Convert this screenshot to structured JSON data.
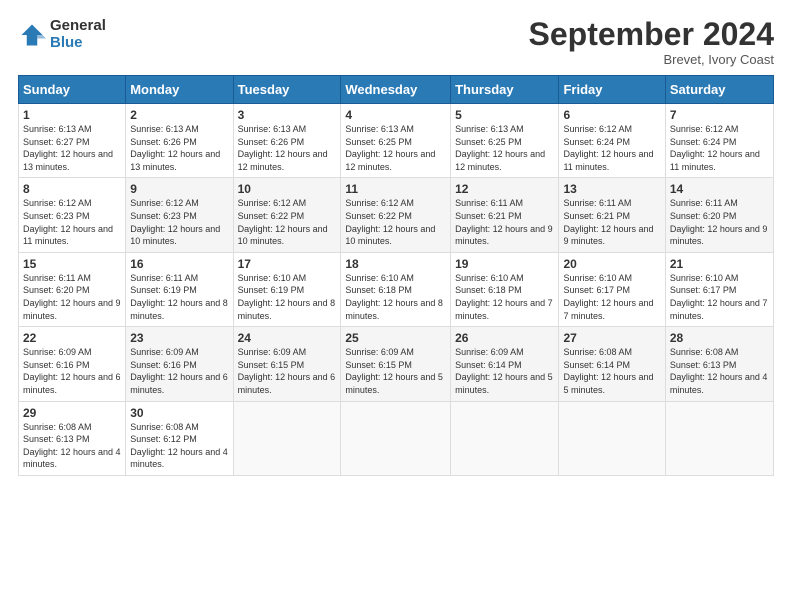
{
  "header": {
    "logo_general": "General",
    "logo_blue": "Blue",
    "month_title": "September 2024",
    "location": "Brevet, Ivory Coast"
  },
  "weekdays": [
    "Sunday",
    "Monday",
    "Tuesday",
    "Wednesday",
    "Thursday",
    "Friday",
    "Saturday"
  ],
  "weeks": [
    [
      {
        "day": "1",
        "sunrise": "Sunrise: 6:13 AM",
        "sunset": "Sunset: 6:27 PM",
        "daylight": "Daylight: 12 hours and 13 minutes."
      },
      {
        "day": "2",
        "sunrise": "Sunrise: 6:13 AM",
        "sunset": "Sunset: 6:26 PM",
        "daylight": "Daylight: 12 hours and 13 minutes."
      },
      {
        "day": "3",
        "sunrise": "Sunrise: 6:13 AM",
        "sunset": "Sunset: 6:26 PM",
        "daylight": "Daylight: 12 hours and 12 minutes."
      },
      {
        "day": "4",
        "sunrise": "Sunrise: 6:13 AM",
        "sunset": "Sunset: 6:25 PM",
        "daylight": "Daylight: 12 hours and 12 minutes."
      },
      {
        "day": "5",
        "sunrise": "Sunrise: 6:13 AM",
        "sunset": "Sunset: 6:25 PM",
        "daylight": "Daylight: 12 hours and 12 minutes."
      },
      {
        "day": "6",
        "sunrise": "Sunrise: 6:12 AM",
        "sunset": "Sunset: 6:24 PM",
        "daylight": "Daylight: 12 hours and 11 minutes."
      },
      {
        "day": "7",
        "sunrise": "Sunrise: 6:12 AM",
        "sunset": "Sunset: 6:24 PM",
        "daylight": "Daylight: 12 hours and 11 minutes."
      }
    ],
    [
      {
        "day": "8",
        "sunrise": "Sunrise: 6:12 AM",
        "sunset": "Sunset: 6:23 PM",
        "daylight": "Daylight: 12 hours and 11 minutes."
      },
      {
        "day": "9",
        "sunrise": "Sunrise: 6:12 AM",
        "sunset": "Sunset: 6:23 PM",
        "daylight": "Daylight: 12 hours and 10 minutes."
      },
      {
        "day": "10",
        "sunrise": "Sunrise: 6:12 AM",
        "sunset": "Sunset: 6:22 PM",
        "daylight": "Daylight: 12 hours and 10 minutes."
      },
      {
        "day": "11",
        "sunrise": "Sunrise: 6:12 AM",
        "sunset": "Sunset: 6:22 PM",
        "daylight": "Daylight: 12 hours and 10 minutes."
      },
      {
        "day": "12",
        "sunrise": "Sunrise: 6:11 AM",
        "sunset": "Sunset: 6:21 PM",
        "daylight": "Daylight: 12 hours and 9 minutes."
      },
      {
        "day": "13",
        "sunrise": "Sunrise: 6:11 AM",
        "sunset": "Sunset: 6:21 PM",
        "daylight": "Daylight: 12 hours and 9 minutes."
      },
      {
        "day": "14",
        "sunrise": "Sunrise: 6:11 AM",
        "sunset": "Sunset: 6:20 PM",
        "daylight": "Daylight: 12 hours and 9 minutes."
      }
    ],
    [
      {
        "day": "15",
        "sunrise": "Sunrise: 6:11 AM",
        "sunset": "Sunset: 6:20 PM",
        "daylight": "Daylight: 12 hours and 9 minutes."
      },
      {
        "day": "16",
        "sunrise": "Sunrise: 6:11 AM",
        "sunset": "Sunset: 6:19 PM",
        "daylight": "Daylight: 12 hours and 8 minutes."
      },
      {
        "day": "17",
        "sunrise": "Sunrise: 6:10 AM",
        "sunset": "Sunset: 6:19 PM",
        "daylight": "Daylight: 12 hours and 8 minutes."
      },
      {
        "day": "18",
        "sunrise": "Sunrise: 6:10 AM",
        "sunset": "Sunset: 6:18 PM",
        "daylight": "Daylight: 12 hours and 8 minutes."
      },
      {
        "day": "19",
        "sunrise": "Sunrise: 6:10 AM",
        "sunset": "Sunset: 6:18 PM",
        "daylight": "Daylight: 12 hours and 7 minutes."
      },
      {
        "day": "20",
        "sunrise": "Sunrise: 6:10 AM",
        "sunset": "Sunset: 6:17 PM",
        "daylight": "Daylight: 12 hours and 7 minutes."
      },
      {
        "day": "21",
        "sunrise": "Sunrise: 6:10 AM",
        "sunset": "Sunset: 6:17 PM",
        "daylight": "Daylight: 12 hours and 7 minutes."
      }
    ],
    [
      {
        "day": "22",
        "sunrise": "Sunrise: 6:09 AM",
        "sunset": "Sunset: 6:16 PM",
        "daylight": "Daylight: 12 hours and 6 minutes."
      },
      {
        "day": "23",
        "sunrise": "Sunrise: 6:09 AM",
        "sunset": "Sunset: 6:16 PM",
        "daylight": "Daylight: 12 hours and 6 minutes."
      },
      {
        "day": "24",
        "sunrise": "Sunrise: 6:09 AM",
        "sunset": "Sunset: 6:15 PM",
        "daylight": "Daylight: 12 hours and 6 minutes."
      },
      {
        "day": "25",
        "sunrise": "Sunrise: 6:09 AM",
        "sunset": "Sunset: 6:15 PM",
        "daylight": "Daylight: 12 hours and 5 minutes."
      },
      {
        "day": "26",
        "sunrise": "Sunrise: 6:09 AM",
        "sunset": "Sunset: 6:14 PM",
        "daylight": "Daylight: 12 hours and 5 minutes."
      },
      {
        "day": "27",
        "sunrise": "Sunrise: 6:08 AM",
        "sunset": "Sunset: 6:14 PM",
        "daylight": "Daylight: 12 hours and 5 minutes."
      },
      {
        "day": "28",
        "sunrise": "Sunrise: 6:08 AM",
        "sunset": "Sunset: 6:13 PM",
        "daylight": "Daylight: 12 hours and 4 minutes."
      }
    ],
    [
      {
        "day": "29",
        "sunrise": "Sunrise: 6:08 AM",
        "sunset": "Sunset: 6:13 PM",
        "daylight": "Daylight: 12 hours and 4 minutes."
      },
      {
        "day": "30",
        "sunrise": "Sunrise: 6:08 AM",
        "sunset": "Sunset: 6:12 PM",
        "daylight": "Daylight: 12 hours and 4 minutes."
      },
      null,
      null,
      null,
      null,
      null
    ]
  ]
}
